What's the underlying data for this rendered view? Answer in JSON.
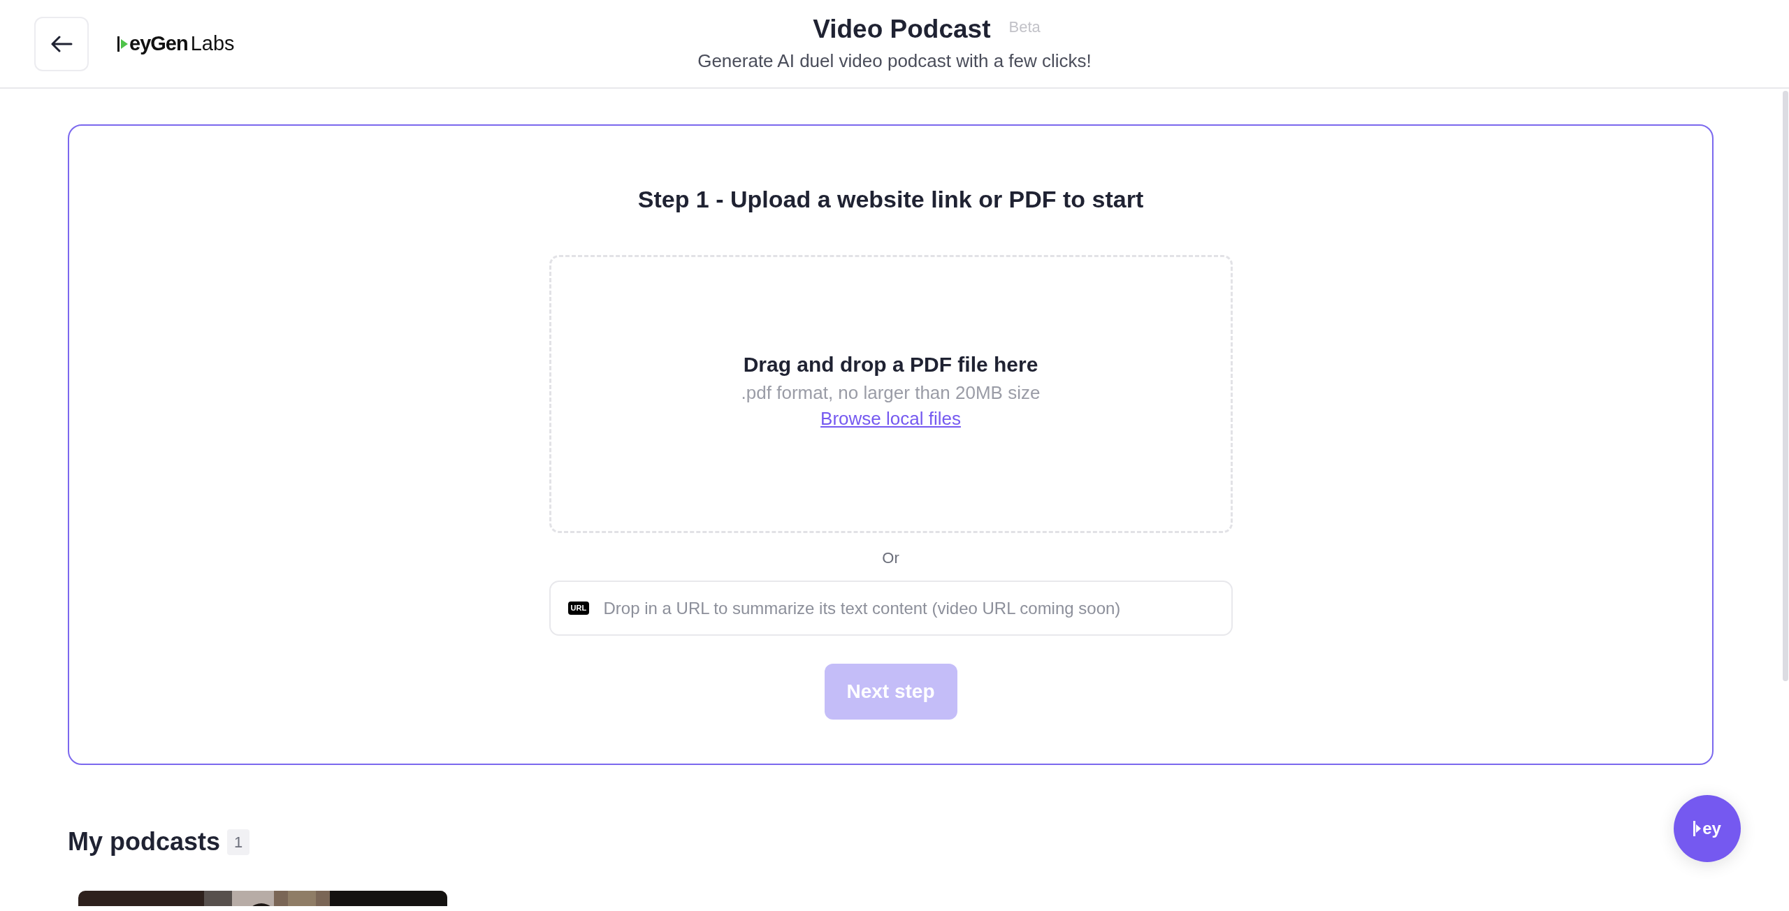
{
  "header": {
    "logo": {
      "name": "eyGen",
      "suffix": "Labs"
    },
    "title": "Video Podcast",
    "badge": "Beta",
    "subtitle": "Generate AI duel video podcast with a few clicks!"
  },
  "upload": {
    "heading": "Step 1 - Upload a website link or PDF to start",
    "dropzone": {
      "title": "Drag and drop a PDF file here",
      "hint": ".pdf format, no larger than 20MB size",
      "link": "Browse local files"
    },
    "separator": "Or",
    "url_field": {
      "icon_label": "URL",
      "placeholder": "Drop in a URL to summarize its text content (video URL coming soon)"
    },
    "next_button": {
      "label": "Next step",
      "disabled": true
    }
  },
  "podcasts": {
    "title": "My podcasts",
    "count": "1"
  },
  "assistant_button": {
    "label": "ey"
  }
}
